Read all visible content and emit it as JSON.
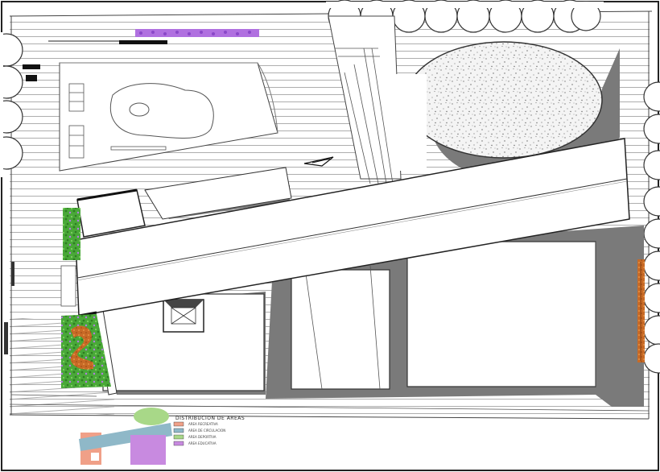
{
  "legend": {
    "title": "DISTRIBUCION DE AREAS",
    "items": [
      {
        "label": "AREA RECREATIVA",
        "color": "#f0a088"
      },
      {
        "label": "AREA DE CIRCULACION",
        "color": "#8fb8c8"
      },
      {
        "label": "AREA DEPORTIVA",
        "color": "#a8d888"
      },
      {
        "label": "AREA EDUCATIVA",
        "color": "#c88ae0"
      }
    ]
  },
  "colors": {
    "shadow": "#7a7a7a",
    "hatch": "#9a9a9a",
    "planting": "#44aa33",
    "flowers": "#b070e0",
    "orange_planting": "#d87830",
    "line": "#444444"
  }
}
